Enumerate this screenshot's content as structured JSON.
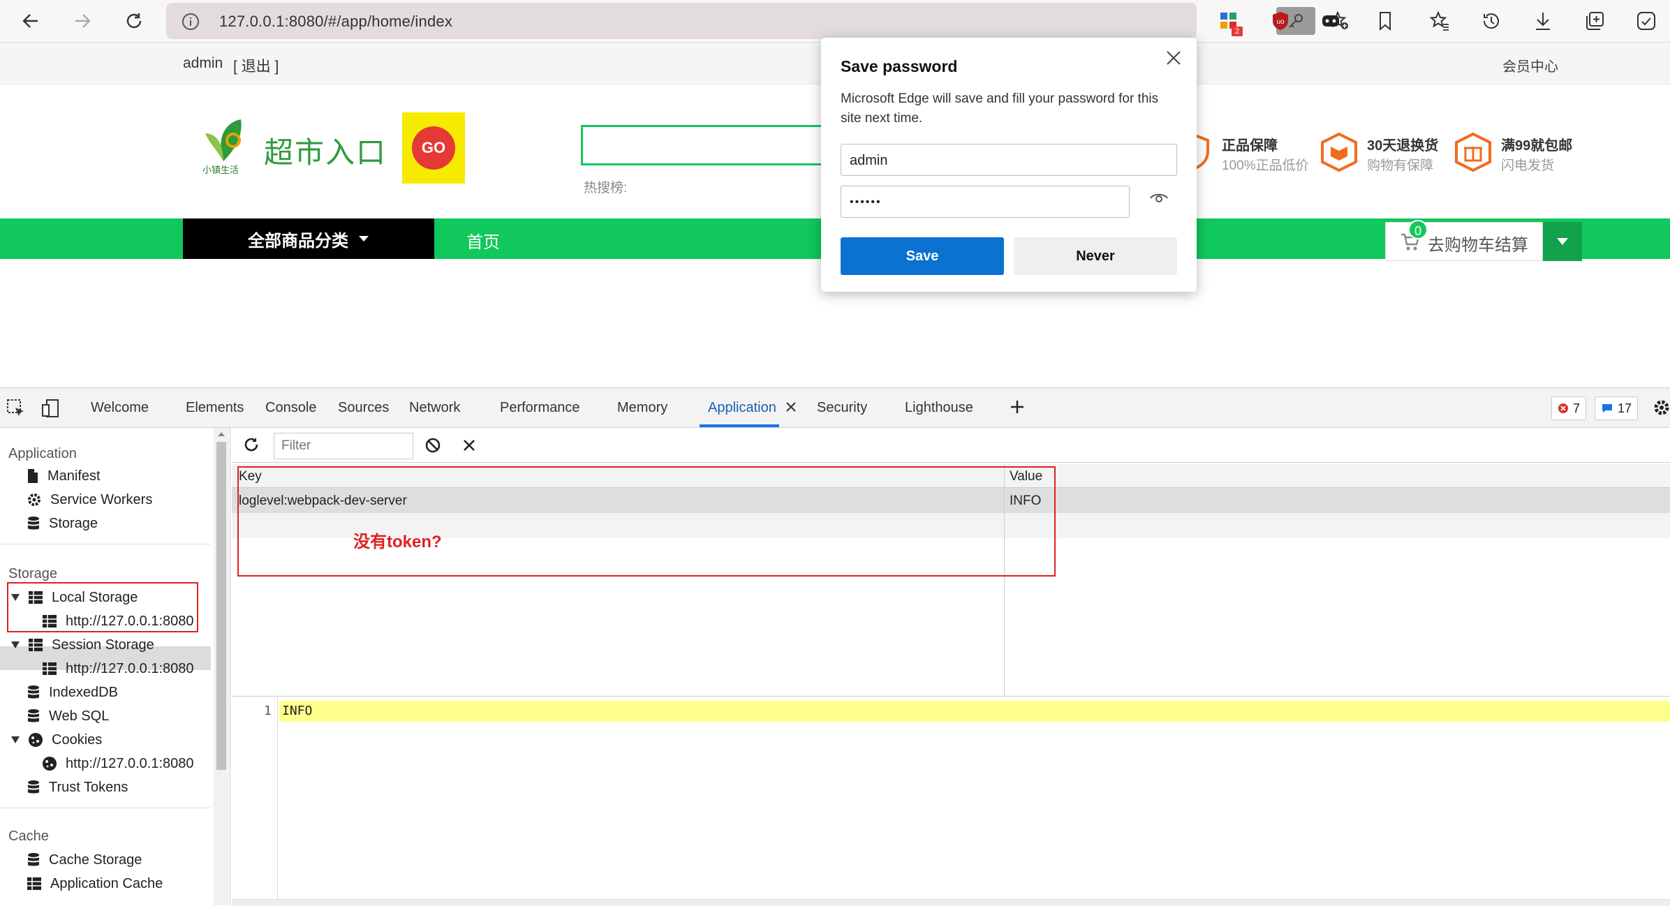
{
  "browser": {
    "url": "127.0.0.1:8080/#/app/home/index",
    "extension_badge": "2"
  },
  "site": {
    "topbar": {
      "user": "admin",
      "logout": "[ 退出 ]",
      "member_center": "会员中心"
    },
    "logo_text": "超市入口",
    "logo_small": "小镇生活",
    "logo_go": "GO",
    "hot_search_label": "热搜榜:",
    "promos": [
      {
        "title": "正品保障",
        "subtitle": "100%正品低价"
      },
      {
        "title": "30天退换货",
        "subtitle": "购物有保障"
      },
      {
        "title": "满99就包邮",
        "subtitle": "闪电发货"
      }
    ],
    "nav": {
      "all_categories": "全部商品分类",
      "home": "首页"
    },
    "cart": {
      "count": "0",
      "label": "去购物车结算"
    },
    "colors": {
      "brand_green": "#10c85b",
      "nav_black": "#000000"
    }
  },
  "password_dialog": {
    "title": "Save password",
    "description": "Microsoft Edge will save and fill your password for this site next time.",
    "username": "admin",
    "password_mask": "••••••",
    "save_label": "Save",
    "never_label": "Never"
  },
  "devtools": {
    "tabs": [
      "Welcome",
      "Elements",
      "Console",
      "Sources",
      "Network",
      "Performance",
      "Memory",
      "Application",
      "Security",
      "Lighthouse"
    ],
    "active_tab": "Application",
    "errors_count": "7",
    "messages_count": "17",
    "sidebar": {
      "application_header": "Application",
      "application_items": [
        "Manifest",
        "Service Workers",
        "Storage"
      ],
      "storage_header": "Storage",
      "local_storage": "Local Storage",
      "local_storage_origin": "http://127.0.0.1:8080",
      "session_storage": "Session Storage",
      "session_storage_origin": "http://127.0.0.1:8080",
      "indexeddb": "IndexedDB",
      "websql": "Web SQL",
      "cookies": "Cookies",
      "cookies_origin": "http://127.0.0.1:8080",
      "trust_tokens": "Trust Tokens",
      "cache_header": "Cache",
      "cache_items": [
        "Cache Storage",
        "Application Cache"
      ]
    },
    "filter_placeholder": "Filter",
    "table": {
      "key_header": "Key",
      "value_header": "Value",
      "rows": [
        {
          "key": "loglevel:webpack-dev-server",
          "value": "INFO"
        }
      ]
    },
    "annotation": "没有token?",
    "preview": {
      "line_number": "1",
      "content": "INFO"
    }
  }
}
